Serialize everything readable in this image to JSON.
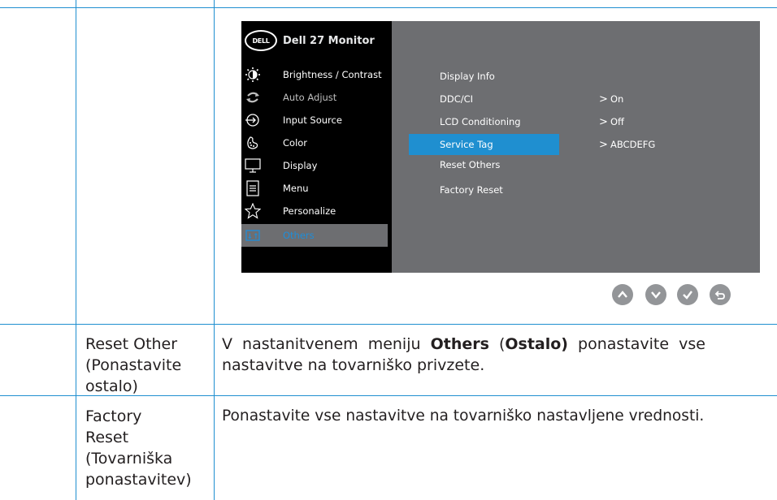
{
  "osd": {
    "logo": "DELL",
    "title": "Dell 27 Monitor",
    "menu": [
      {
        "label": "Brightness / Contrast",
        "icon": "brightness-icon",
        "state": "normal"
      },
      {
        "label": "Auto Adjust",
        "icon": "auto-adjust-icon",
        "state": "dim"
      },
      {
        "label": "Input Source",
        "icon": "input-source-icon",
        "state": "normal"
      },
      {
        "label": "Color",
        "icon": "color-icon",
        "state": "normal"
      },
      {
        "label": "Display",
        "icon": "display-icon",
        "state": "normal"
      },
      {
        "label": "Menu",
        "icon": "menu-icon",
        "state": "normal"
      },
      {
        "label": "Personalize",
        "icon": "star-icon",
        "state": "normal"
      },
      {
        "label": "Others",
        "icon": "others-icon",
        "state": "selected"
      }
    ],
    "submenu": [
      {
        "label": "Display Info"
      },
      {
        "label": "DDC/CI",
        "value": "On"
      },
      {
        "label": "LCD Conditioning",
        "value": "Off"
      },
      {
        "label": "Service Tag",
        "value": "ABCDEFG",
        "highlighted": true
      },
      {
        "label": "Reset Others"
      },
      {
        "label": "Factory Reset"
      }
    ],
    "value_chevron": ">",
    "nav_buttons": [
      "up-icon",
      "down-icon",
      "check-icon",
      "back-icon"
    ],
    "colors": {
      "highlight": "#1f8fd0",
      "panel": "#6d6e71",
      "menu_bg": "#000000"
    }
  },
  "rows": [
    {
      "name_lines": [
        "Reset Other",
        "(Ponastavite",
        "ostalo)"
      ],
      "desc_prefix": "V nastanitvenem meniju ",
      "desc_bold1": "Others",
      "desc_mid": " (",
      "desc_bold2": "Ostalo)",
      "desc_suffix": " ponastavite vse",
      "desc_line2": "nastavitve na tovarniško privzete."
    },
    {
      "name_lines": [
        "Factory",
        "Reset",
        "(Tovarniška",
        "ponastavitev)"
      ],
      "desc": "Ponastavite vse nastavitve na tovarniško nastavljene vrednosti."
    }
  ]
}
